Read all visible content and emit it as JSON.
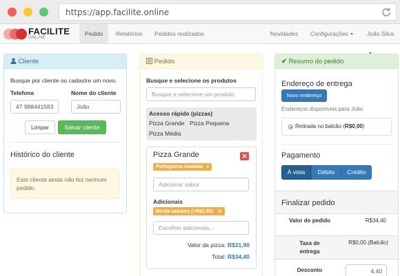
{
  "browser": {
    "url": "https://app.facilite.online"
  },
  "brand": {
    "name": "FACILITE",
    "sub": "ONLINE"
  },
  "nav": {
    "items": [
      "Pedido",
      "Relatórios",
      "Pedidos realizados"
    ],
    "right": [
      "Novidades",
      "Configurações",
      "João Silva"
    ]
  },
  "cliente": {
    "title": "Cliente",
    "hint": "Busque por cliente ou cadastre um novo.",
    "telefone_label": "Telefone",
    "telefone_value": "47 988441583",
    "nome_label": "Nome do cliente",
    "nome_value": "João",
    "limpar": "Limpar",
    "salvar": "Salvar cliente",
    "historico_title": "Histórico do cliente",
    "historico_empty": "Este cliente ainda não fez nenhum pedido."
  },
  "pedido": {
    "title": "Pedido",
    "busca_label": "Busque e selecione os produtos",
    "busca_placeholder": "Busque e selecione um produto",
    "acesso_title": "Acesso rápido (pizzas)",
    "acesso_items": [
      "Pizza Grande",
      "Pizza Pequena",
      "Pizza Média"
    ],
    "item": {
      "name": "Pizza Grande",
      "sabor_tag": "Portuguesa",
      "sabor_strike": "Azeitona",
      "sabor_placeholder": "Adicionar sabor",
      "adicionais_label": "Adicionais",
      "adicional_tag": "Borda catupiry",
      "adicional_price": "(+R$2,50)",
      "adicionais_placeholder": "Escolher adicionais...",
      "valor_label": "Valor da pizza:",
      "valor": "R$31,90",
      "total_label": "Total:",
      "total": "R$34,40"
    }
  },
  "resumo": {
    "title": "Resumo do pedido",
    "endereco_title": "Endereço de entrega",
    "novo_endereco": "Novo endereço",
    "enderecos_hint": "Endereços disponíveis para João",
    "retirada_label": "Retirada no balcão",
    "retirada_value": "R$0,00",
    "pagamento_title": "Pagamento",
    "pagamento_options": [
      "À vista",
      "Débito",
      "Crédito"
    ],
    "finalizar_title": "Finalizar pedido",
    "valor_label": "Valor do pedido",
    "valor": "R$34,40",
    "taxa_label": "Taxa de entrega",
    "taxa": "R$0,00",
    "taxa_note": "(Balcão)",
    "desconto_label": "Desconto",
    "desconto_value": "4.40"
  },
  "colors": {
    "primary": "#337ab7",
    "success": "#5cb85c",
    "warning": "#f0ad4e",
    "danger": "#d9534f"
  }
}
